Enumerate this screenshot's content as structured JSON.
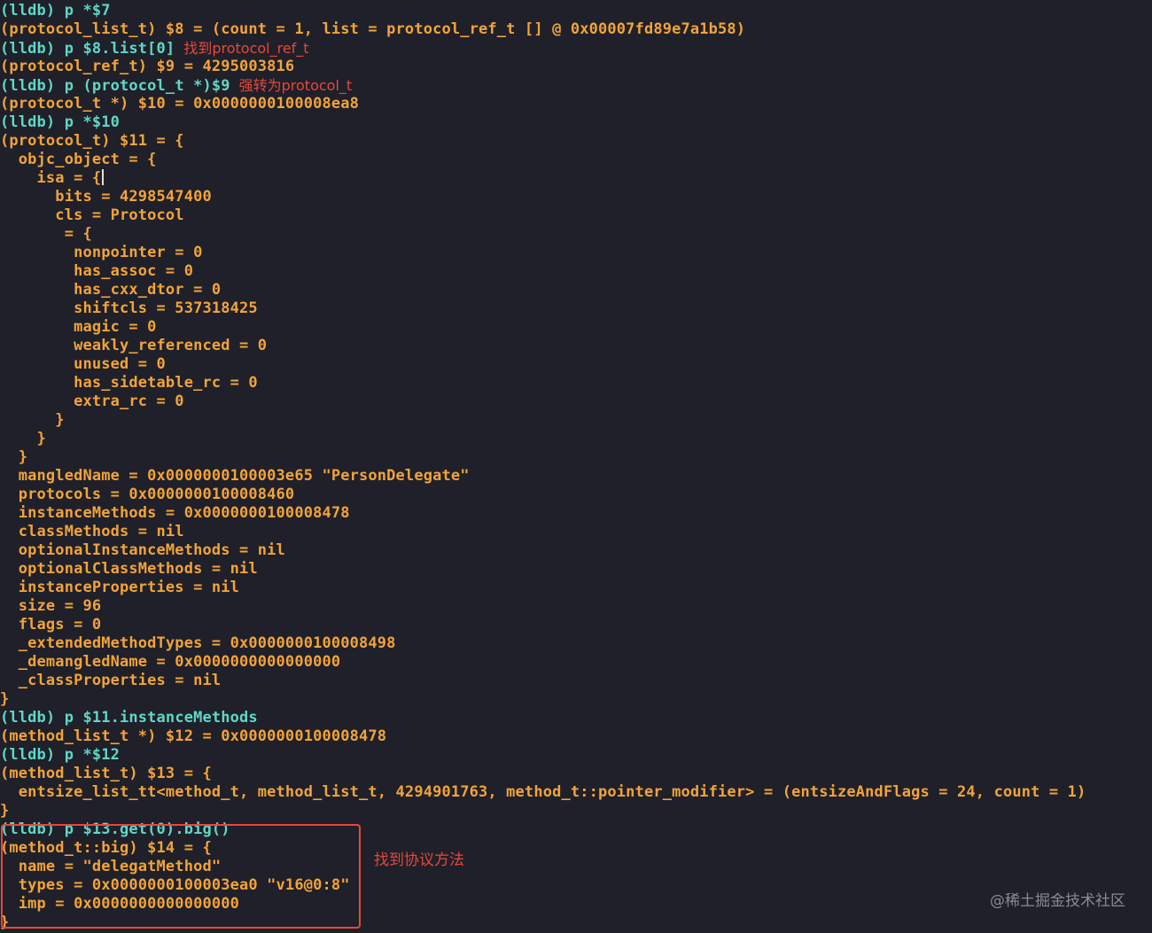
{
  "colors": {
    "background": "#1f2029",
    "prompt": "#5fd7c8",
    "output": "#f2a33a",
    "annotation": "#e8473b",
    "watermark": "#8a8b92"
  },
  "console": {
    "lines": [
      {
        "kind": "cmd",
        "prompt": "(lldb)",
        "text": " p *$7",
        "note": ""
      },
      {
        "kind": "out",
        "text": "(protocol_list_t) $8 = (count = 1, list = protocol_ref_t [] @ 0x00007fd89e7a1b58)"
      },
      {
        "kind": "cmd",
        "prompt": "(lldb)",
        "text": " p $8.list[0]",
        "note": "找到protocol_ref_t"
      },
      {
        "kind": "out",
        "text": "(protocol_ref_t) $9 = 4295003816"
      },
      {
        "kind": "cmd",
        "prompt": "(lldb)",
        "text": " p (protocol_t *)$9",
        "note": "强转为protocol_t"
      },
      {
        "kind": "out",
        "text": "(protocol_t *) $10 = 0x0000000100008ea8"
      },
      {
        "kind": "cmd",
        "prompt": "(lldb)",
        "text": " p *$10",
        "note": ""
      },
      {
        "kind": "out",
        "text": "(protocol_t) $11 = {"
      },
      {
        "kind": "out",
        "text": "  objc_object = {"
      },
      {
        "kind": "out",
        "text": "    isa = {",
        "cursor": true
      },
      {
        "kind": "out",
        "text": "      bits = 4298547400"
      },
      {
        "kind": "out",
        "text": "      cls = Protocol"
      },
      {
        "kind": "out",
        "text": "       = {"
      },
      {
        "kind": "out",
        "text": "        nonpointer = 0"
      },
      {
        "kind": "out",
        "text": "        has_assoc = 0"
      },
      {
        "kind": "out",
        "text": "        has_cxx_dtor = 0"
      },
      {
        "kind": "out",
        "text": "        shiftcls = 537318425"
      },
      {
        "kind": "out",
        "text": "        magic = 0"
      },
      {
        "kind": "out",
        "text": "        weakly_referenced = 0"
      },
      {
        "kind": "out",
        "text": "        unused = 0"
      },
      {
        "kind": "out",
        "text": "        has_sidetable_rc = 0"
      },
      {
        "kind": "out",
        "text": "        extra_rc = 0"
      },
      {
        "kind": "out",
        "text": "      }"
      },
      {
        "kind": "out",
        "text": "    }"
      },
      {
        "kind": "out",
        "text": "  }"
      },
      {
        "kind": "out",
        "text": "  mangledName = 0x0000000100003e65 \"PersonDelegate\""
      },
      {
        "kind": "out",
        "text": "  protocols = 0x0000000100008460"
      },
      {
        "kind": "out",
        "text": "  instanceMethods = 0x0000000100008478"
      },
      {
        "kind": "out",
        "text": "  classMethods = nil"
      },
      {
        "kind": "out",
        "text": "  optionalInstanceMethods = nil"
      },
      {
        "kind": "out",
        "text": "  optionalClassMethods = nil"
      },
      {
        "kind": "out",
        "text": "  instanceProperties = nil"
      },
      {
        "kind": "out",
        "text": "  size = 96"
      },
      {
        "kind": "out",
        "text": "  flags = 0"
      },
      {
        "kind": "out",
        "text": "  _extendedMethodTypes = 0x0000000100008498"
      },
      {
        "kind": "out",
        "text": "  _demangledName = 0x0000000000000000"
      },
      {
        "kind": "out",
        "text": "  _classProperties = nil"
      },
      {
        "kind": "out",
        "text": "}"
      },
      {
        "kind": "cmd",
        "prompt": "(lldb)",
        "text": " p $11.instanceMethods",
        "note": ""
      },
      {
        "kind": "out",
        "text": "(method_list_t *) $12 = 0x0000000100008478"
      },
      {
        "kind": "cmd",
        "prompt": "(lldb)",
        "text": " p *$12",
        "note": ""
      },
      {
        "kind": "out",
        "text": "(method_list_t) $13 = {"
      },
      {
        "kind": "out",
        "text": "  entsize_list_tt<method_t, method_list_t, 4294901763, method_t::pointer_modifier> = (entsizeAndFlags = 24, count = 1)"
      },
      {
        "kind": "out",
        "text": "}"
      },
      {
        "kind": "cmd",
        "prompt": "(lldb)",
        "text": " p $13.get(0).big()",
        "note": ""
      },
      {
        "kind": "out",
        "text": "(method_t::big) $14 = {"
      },
      {
        "kind": "out",
        "text": "  name = \"delegatMethod\""
      },
      {
        "kind": "out",
        "text": "  types = 0x0000000100003ea0 \"v16@0:8\""
      },
      {
        "kind": "out",
        "text": "  imp = 0x0000000000000000"
      },
      {
        "kind": "out",
        "text": "}"
      }
    ]
  },
  "highlight": {
    "note": "找到协议方法"
  },
  "watermark": "@稀土掘金技术社区"
}
